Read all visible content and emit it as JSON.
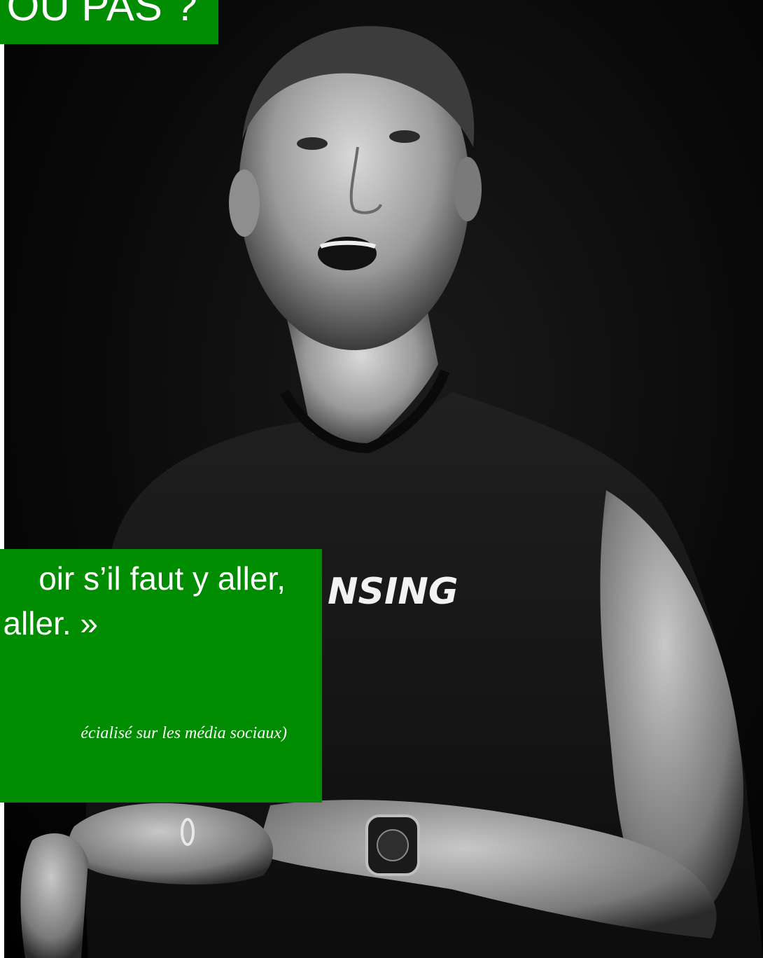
{
  "title": {
    "text": "OU PAS ?",
    "background": "#008c00",
    "color": "#ffffff"
  },
  "quote": {
    "line1": "oir s’il faut y aller,",
    "line2": "aller. »",
    "attribution": "écialisé sur les média sociaux)",
    "background": "#008c00",
    "color": "#ffffff"
  },
  "photo": {
    "description_icon": "speaker-portrait",
    "shirt_text": "NSING"
  }
}
